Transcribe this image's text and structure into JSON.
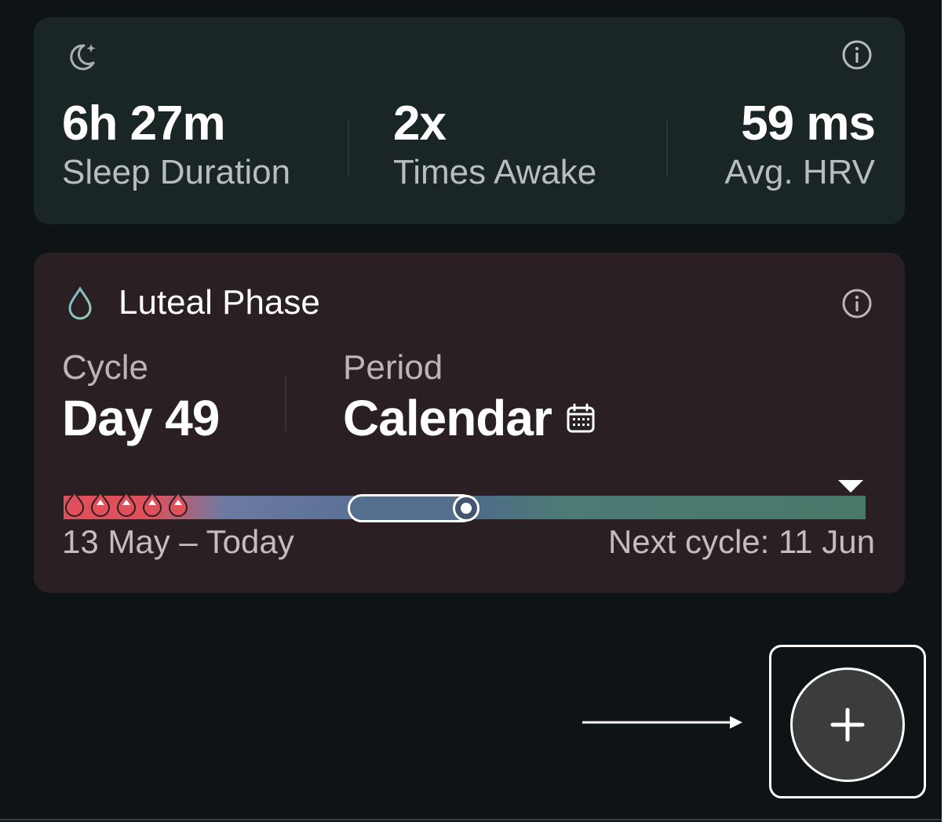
{
  "sleep": {
    "icon": "moon-sparkle-icon",
    "info_icon": "info-icon",
    "stats": [
      {
        "value": "6h 27m",
        "label": "Sleep Duration"
      },
      {
        "value": "2x",
        "label": "Times Awake"
      },
      {
        "value": "59 ms",
        "label": "Avg. HRV"
      }
    ]
  },
  "cycle": {
    "icon": "drop-icon",
    "info_icon": "info-icon",
    "title": "Luteal Phase",
    "cycle_caption": "Cycle",
    "cycle_value": "Day 49",
    "period_caption": "Period",
    "period_value": "Calendar",
    "period_icon": "calendar-icon",
    "date_range": "13 May – Today",
    "next_cycle": "Next cycle: 11 Jun",
    "colors": {
      "period": "#e0505a",
      "luteal": "#4a7868",
      "follicular": "#4d6a8c"
    }
  },
  "fab": {
    "icon": "plus-icon"
  }
}
